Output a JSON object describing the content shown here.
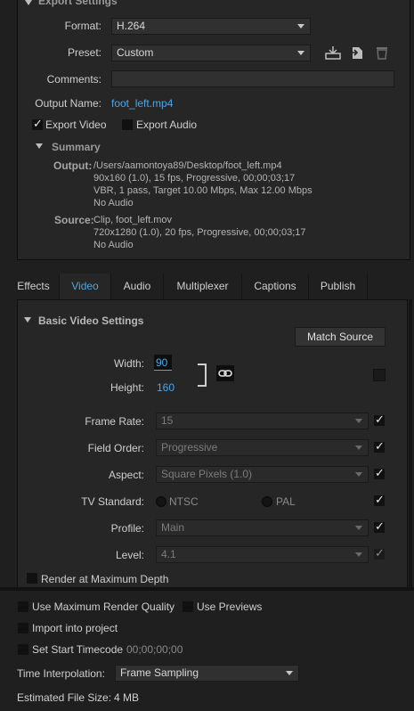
{
  "export_settings": {
    "heading": "Export Settings",
    "format_label": "Format:",
    "format_value": "H.264",
    "preset_label": "Preset:",
    "preset_value": "Custom",
    "comments_label": "Comments:",
    "comments_value": "",
    "output_name_label": "Output Name:",
    "output_name_value": "foot_left.mp4",
    "export_video_label": "Export Video",
    "export_video_checked": true,
    "export_audio_label": "Export Audio",
    "export_audio_checked": false
  },
  "summary": {
    "heading": "Summary",
    "output_label": "Output:",
    "output_lines": [
      "/Users/aamontoya89/Desktop/foot_left.mp4",
      "90x160 (1.0), 15 fps, Progressive, 00;00;03;17",
      "VBR, 1 pass, Target 10.00 Mbps, Max 12.00 Mbps",
      "No Audio"
    ],
    "source_label": "Source:",
    "source_lines": [
      "Clip, foot_left.mov",
      "720x1280 (1.0), 20 fps, Progressive, 00;00;03;17",
      "No Audio"
    ]
  },
  "tabs": [
    "Effects",
    "Video",
    "Audio",
    "Multiplexer",
    "Captions",
    "Publish"
  ],
  "active_tab": "Video",
  "video": {
    "heading": "Basic Video Settings",
    "match_source": "Match Source",
    "width_label": "Width:",
    "width_value": "90",
    "height_label": "Height:",
    "height_value": "160",
    "frame_rate_label": "Frame Rate:",
    "frame_rate_value": "15",
    "field_order_label": "Field Order:",
    "field_order_value": "Progressive",
    "aspect_label": "Aspect:",
    "aspect_value": "Square Pixels (1.0)",
    "tv_standard_label": "TV Standard:",
    "ntsc_label": "NTSC",
    "pal_label": "PAL",
    "profile_label": "Profile:",
    "profile_value": "Main",
    "level_label": "Level:",
    "level_value": "4.1",
    "render_max_depth_label": "Render at Maximum Depth"
  },
  "bottom": {
    "max_render_quality_label": "Use Maximum Render Quality",
    "use_previews_label": "Use Previews",
    "import_into_project_label": "Import into project",
    "set_start_timecode_label": "Set Start Timecode",
    "start_timecode_value": "00;00;00;00",
    "time_interpolation_label": "Time Interpolation:",
    "time_interpolation_value": "Frame Sampling",
    "estimated_file_size_label": "Estimated File Size:",
    "estimated_file_size_value": "4 MB"
  },
  "colors": {
    "background": "#1f1f1f",
    "panel": "#262626",
    "accent_blue": "#4aa7e8",
    "text": "#cfcfcf"
  }
}
